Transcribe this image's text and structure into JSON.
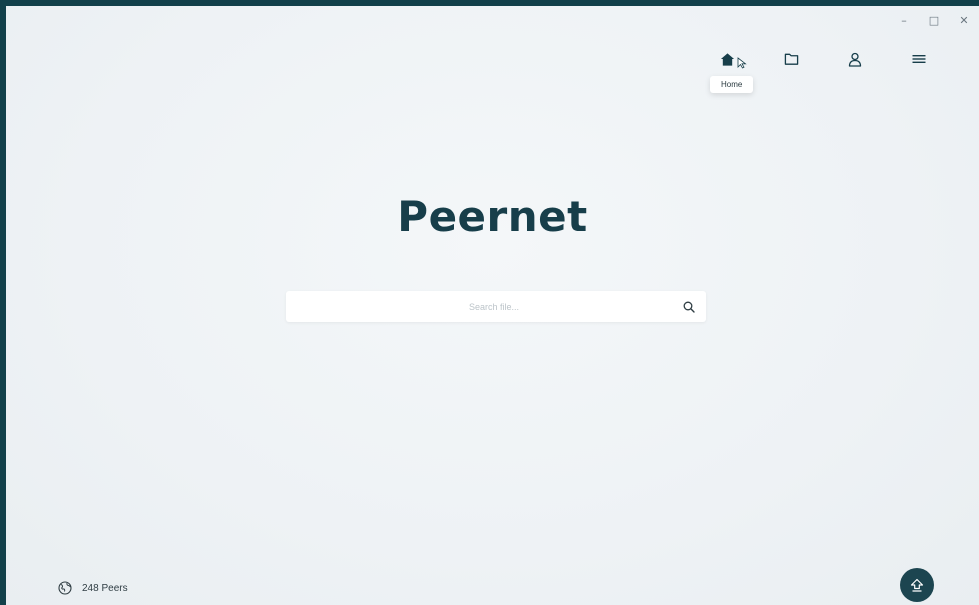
{
  "window": {
    "controls": {
      "minimize_label": "–",
      "maximize_label": "□",
      "close_label": "✕"
    }
  },
  "nav": {
    "items": [
      {
        "name": "home",
        "icon": "home-icon"
      },
      {
        "name": "files",
        "icon": "folder-icon"
      },
      {
        "name": "profile",
        "icon": "user-icon"
      },
      {
        "name": "menu",
        "icon": "hamburger-icon"
      }
    ],
    "tooltip": "Home"
  },
  "brand": {
    "logo_text": "Peernet",
    "color": "#173e4a"
  },
  "search": {
    "placeholder": "Search file...",
    "value": "",
    "icon": "search-icon"
  },
  "status": {
    "peers_text": "248 Peers",
    "icon": "globe-icon"
  },
  "upload": {
    "icon": "upload-icon",
    "bg_color": "#1c4550"
  }
}
